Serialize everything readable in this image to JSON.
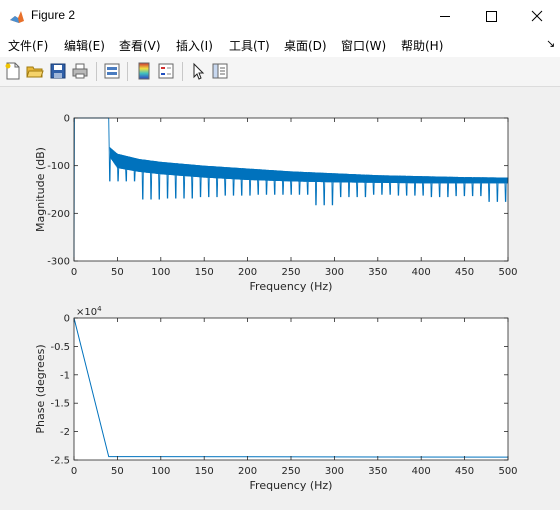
{
  "window": {
    "title": "Figure 2"
  },
  "menu": [
    {
      "label": "文件(F)"
    },
    {
      "label": "编辑(E)"
    },
    {
      "label": "查看(V)"
    },
    {
      "label": "插入(I)"
    },
    {
      "label": "工具(T)"
    },
    {
      "label": "桌面(D)"
    },
    {
      "label": "窗口(W)"
    },
    {
      "label": "帮助(H)"
    }
  ],
  "toolbar": {
    "icons": [
      "new-figure-icon",
      "open-file-icon",
      "save-icon",
      "print-icon",
      "link-plot-icon",
      "insert-colorbar-icon",
      "insert-legend-icon",
      "edit-plot-icon",
      "property-inspector-icon"
    ]
  },
  "chart_data": [
    {
      "type": "line",
      "xlabel": "Frequency (Hz)",
      "ylabel": "Magnitude (dB)",
      "xlim": [
        0,
        500
      ],
      "ylim": [
        -300,
        0
      ],
      "xticks": [
        "0",
        "50",
        "100",
        "150",
        "200",
        "250",
        "300",
        "350",
        "400",
        "450",
        "500"
      ],
      "yticks": [
        "0",
        "-100",
        "-200",
        "-300"
      ],
      "color": "#0072bd",
      "series": [
        {
          "x": [
            0,
            0.5,
            40,
            40.5,
            50,
            75,
            100,
            150,
            200,
            250,
            300,
            350,
            400,
            450,
            500
          ],
          "upper": [
            -300,
            0,
            0,
            -60,
            -75,
            -86,
            -92,
            -100,
            -106,
            -112,
            -116,
            -120,
            -122,
            -124,
            -125
          ],
          "lower": [
            -300,
            0,
            0,
            -80,
            -105,
            -113,
            -118,
            -125,
            -130,
            -133,
            -135,
            -136,
            -137,
            -137,
            -137
          ],
          "notch_spacing_hz": 9.5,
          "notch_lows": [
            -132,
            -170,
            -168,
            -165,
            -162,
            -160,
            -160,
            -182,
            -165,
            -160,
            -162,
            -165,
            -163,
            -175
          ]
        }
      ]
    },
    {
      "type": "line",
      "xlabel": "Frequency (Hz)",
      "ylabel": "Phase (degrees)",
      "exponent": "×10^4",
      "xlim": [
        0,
        500
      ],
      "ylim": [
        -2.5,
        0
      ],
      "xticks": [
        "0",
        "50",
        "100",
        "150",
        "200",
        "250",
        "300",
        "350",
        "400",
        "450",
        "500"
      ],
      "yticks": [
        "0",
        "-0.5",
        "-1",
        "-1.5",
        "-2",
        "-2.5"
      ],
      "color": "#0072bd",
      "series": [
        {
          "x": [
            0,
            40,
            500
          ],
          "y": [
            0,
            -2.44,
            -2.45
          ]
        }
      ]
    }
  ]
}
